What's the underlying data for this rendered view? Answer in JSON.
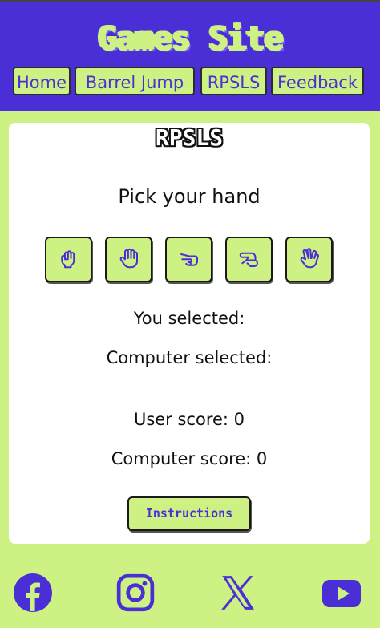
{
  "header": {
    "site_title": "Games Site",
    "nav": [
      "Home",
      "Barrel Jump",
      "RPSLS",
      "Feedback"
    ]
  },
  "game": {
    "title": "RPSLS",
    "prompt": "Pick your hand",
    "hands": [
      "rock-hand-icon",
      "paper-hand-icon",
      "scissors-hand-icon",
      "lizard-hand-icon",
      "spock-hand-icon"
    ],
    "you_selected_label": "You selected:",
    "computer_selected_label": "Computer selected:",
    "user_score_label": "User score: 0",
    "computer_score_label": "Computer score: 0",
    "instructions_label": "Instructions"
  },
  "footer": {
    "icons": [
      "facebook-icon",
      "instagram-icon",
      "x-icon",
      "youtube-icon"
    ]
  },
  "colors": {
    "primary": "#4a2fd6",
    "accent": "#cdf283",
    "card": "#ffffff",
    "text": "#111111"
  }
}
